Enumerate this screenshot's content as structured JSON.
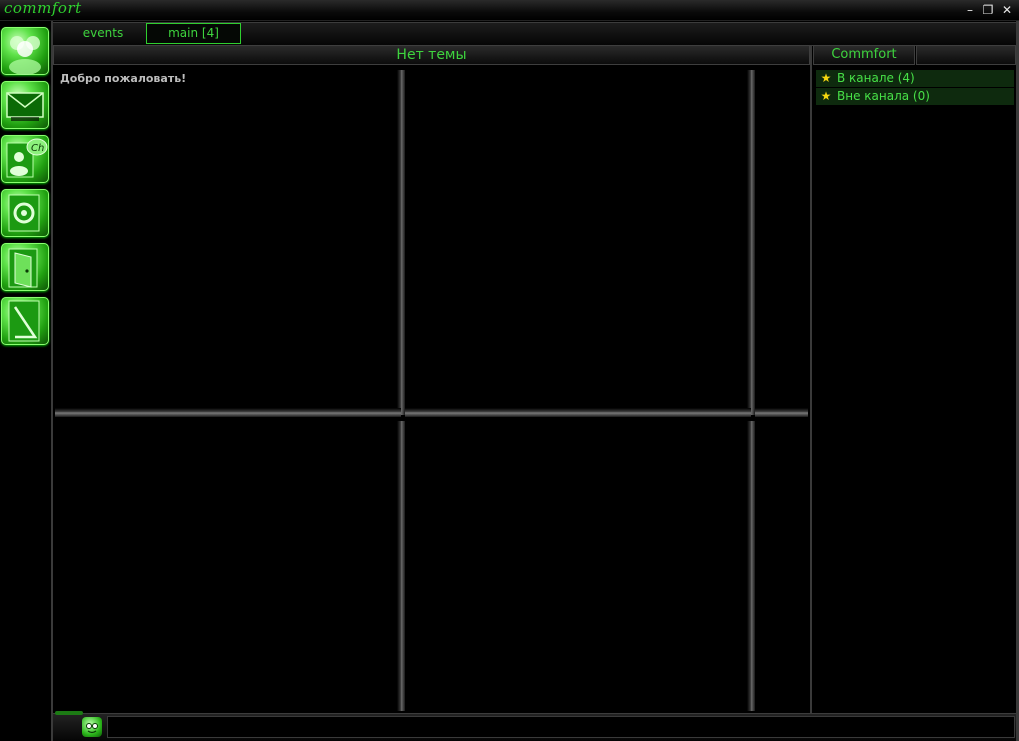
{
  "window": {
    "title": "commfort",
    "minimize": "–",
    "restore": "❐",
    "close": "✕"
  },
  "sidebar": {
    "buttons": [
      {
        "icon": "users-icon"
      },
      {
        "icon": "mail-icon"
      },
      {
        "icon": "channel-icon"
      },
      {
        "icon": "settings-icon"
      },
      {
        "icon": "exit-icon"
      },
      {
        "icon": "file-icon"
      }
    ]
  },
  "tabs": [
    {
      "label": "events"
    },
    {
      "label": "main [4]"
    }
  ],
  "channel": {
    "topic": "Нет темы",
    "welcome": "Добро пожаловать!"
  },
  "userlist": {
    "header": "Commfort",
    "items": [
      {
        "label": "В канале (4)"
      },
      {
        "label": "Вне канала (0)"
      }
    ]
  },
  "colors": {
    "accent": "#3ed43e",
    "star": "#f5d60f"
  }
}
